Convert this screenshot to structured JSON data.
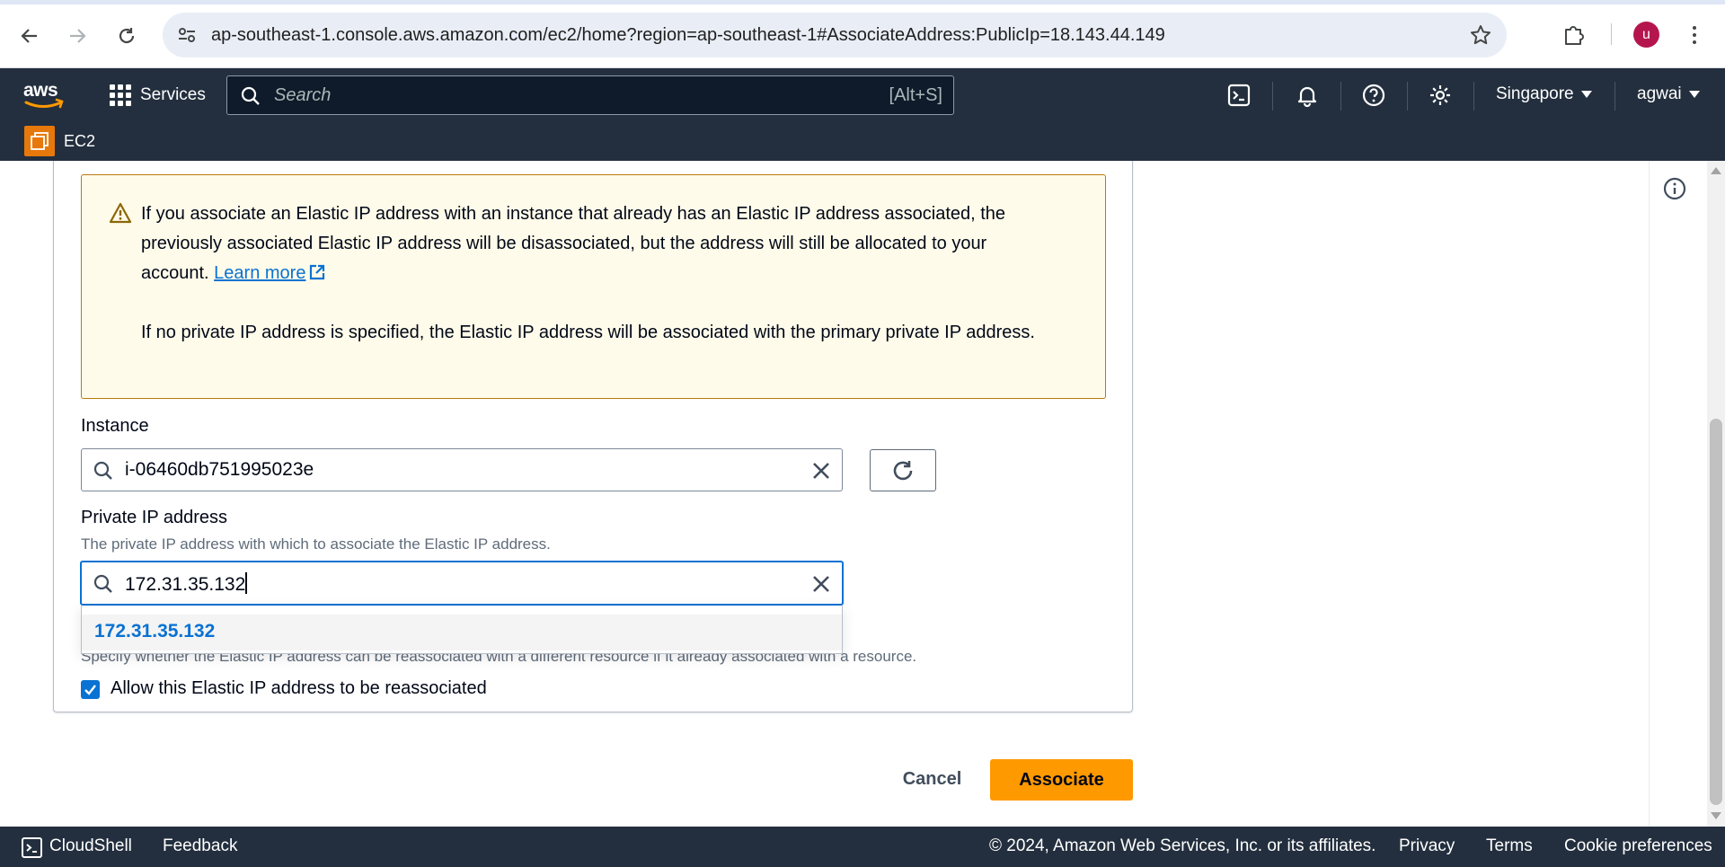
{
  "browser": {
    "url": "ap-southeast-1.console.aws.amazon.com/ec2/home?region=ap-southeast-1#AssociateAddress:PublicIp=18.143.44.149",
    "profile_initial": "u"
  },
  "aws_nav": {
    "services_label": "Services",
    "search_placeholder": "Search",
    "search_shortcut": "[Alt+S]",
    "region_label": "Singapore",
    "user_label": "agwai",
    "service_name": "EC2"
  },
  "alert": {
    "paragraph1": "If you associate an Elastic IP address with an instance that already has an Elastic IP address associated, the previously associated Elastic IP address will be disassociated, but the address will still be allocated to your account.",
    "learn_more": "Learn more",
    "paragraph2": "If no private IP address is specified, the Elastic IP address will be associated with the primary private IP address."
  },
  "form": {
    "instance_label": "Instance",
    "instance_value": "i-06460db751995023e",
    "private_ip_label": "Private IP address",
    "private_ip_description": "The private IP address with which to associate the Elastic IP address.",
    "private_ip_value": "172.31.35.132",
    "dropdown_options": [
      "172.31.35.132"
    ],
    "reassociation_description": "Specify whether the Elastic IP address can be reassociated with a different resource if it already associated with a resource.",
    "reassociation_checkbox_label": "Allow this Elastic IP address to be reassociated",
    "reassociation_checked": true
  },
  "actions": {
    "cancel_label": "Cancel",
    "associate_label": "Associate"
  },
  "footer": {
    "cloudshell": "CloudShell",
    "feedback": "Feedback",
    "copyright": "© 2024, Amazon Web Services, Inc. or its affiliates.",
    "privacy": "Privacy",
    "terms": "Terms",
    "cookie_preferences": "Cookie preferences"
  },
  "colors": {
    "aws_nav_bg": "#232f3e",
    "primary_button": "#ff9900",
    "link_blue": "#0972d3",
    "alert_bg": "#fffbea",
    "alert_border": "#b97a12"
  }
}
